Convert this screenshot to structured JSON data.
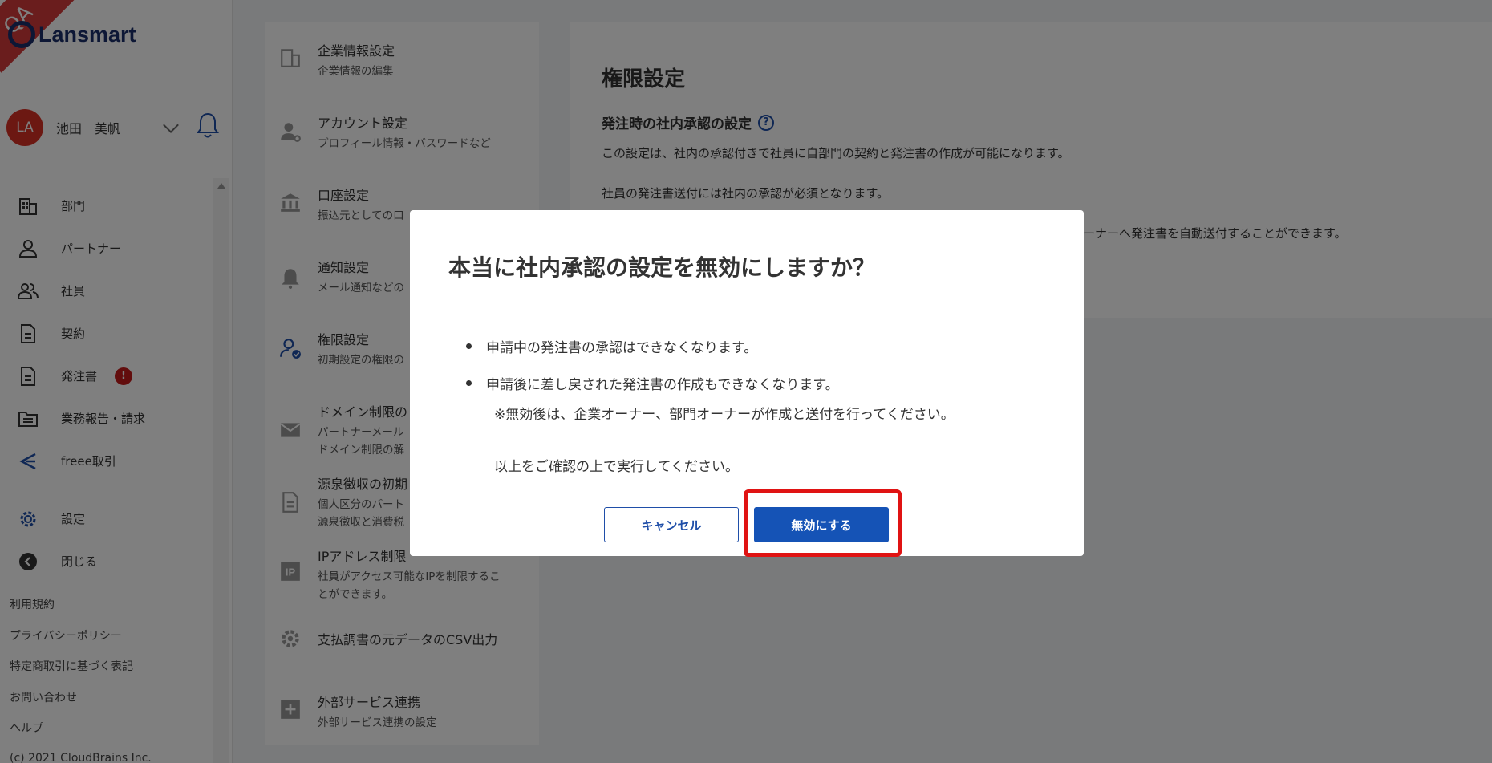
{
  "brand": {
    "logo_text": "Lansmart",
    "ribbon": "QA"
  },
  "user": {
    "initials": "LA",
    "name": "池田　美帆"
  },
  "nav": [
    {
      "label": "部門",
      "icon": "building-icon"
    },
    {
      "label": "パートナー",
      "icon": "person-icon"
    },
    {
      "label": "社員",
      "icon": "people-icon"
    },
    {
      "label": "契約",
      "icon": "document-icon"
    },
    {
      "label": "発注書",
      "icon": "document-icon",
      "badge": "!"
    },
    {
      "label": "業務報告・請求",
      "icon": "folder-icon"
    },
    {
      "label": "freee取引",
      "icon": "freee-icon"
    }
  ],
  "nav_bottom": [
    {
      "label": "設定",
      "icon": "gear-icon"
    },
    {
      "label": "閉じる",
      "icon": "back-arrow-icon"
    }
  ],
  "footer": {
    "links": [
      "利用規約",
      "プライバシーポリシー",
      "特定商取引に基づく表記",
      "お問い合わせ",
      "ヘルプ"
    ],
    "copyright": "(c) 2021 CloudBrains Inc."
  },
  "settings_menu": [
    {
      "title": "企業情報設定",
      "sub": "企業情報の編集"
    },
    {
      "title": "アカウント設定",
      "sub": "プロフィール情報・パスワードなど"
    },
    {
      "title": "口座設定",
      "sub": "振込元としての口"
    },
    {
      "title": "通知設定",
      "sub": "メール通知などの"
    },
    {
      "title": "権限設定",
      "sub": "初期設定の権限の"
    },
    {
      "title": "ドメイン制限の",
      "sub": "パートナーメール\nドメイン制限の解"
    },
    {
      "title": "源泉徴収の初期",
      "sub": "個人区分のパート\n源泉徴収と消費税"
    },
    {
      "title": "IPアドレス制限",
      "sub": "社員がアクセス可能なIPを制限するこ\nとができます。"
    },
    {
      "title": "支払調書の元データのCSV出力",
      "sub": ""
    },
    {
      "title": "外部サービス連携",
      "sub": "外部サービス連携の設定"
    }
  ],
  "panel": {
    "title": "権限設定",
    "subtitle": "発注時の社内承認の設定",
    "line1": "この設定は、社内の承認付きで社員に自部門の契約と発注書の作成が可能になります。",
    "line2": "社員の発注書送付には社内の承認が必須となります。",
    "line3": "ーナーへ発注書を自動送付することができます。"
  },
  "modal": {
    "title": "本当に社内承認の設定を無効にしますか？",
    "bullets": [
      "申請中の発注書の承認はできなくなります。",
      "申請後に差し戻された発注書の作成もできなくなります。"
    ],
    "note": "※無効後は、企業オーナー、部門オーナーが作成と送付を行ってください。",
    "confirm": "以上をご確認の上で実行してください。",
    "cancel_label": "キャンセル",
    "disable_label": "無効にする"
  },
  "colors": {
    "primary": "#1553b6",
    "danger": "#e01313",
    "brand": "#1a2f6b"
  }
}
